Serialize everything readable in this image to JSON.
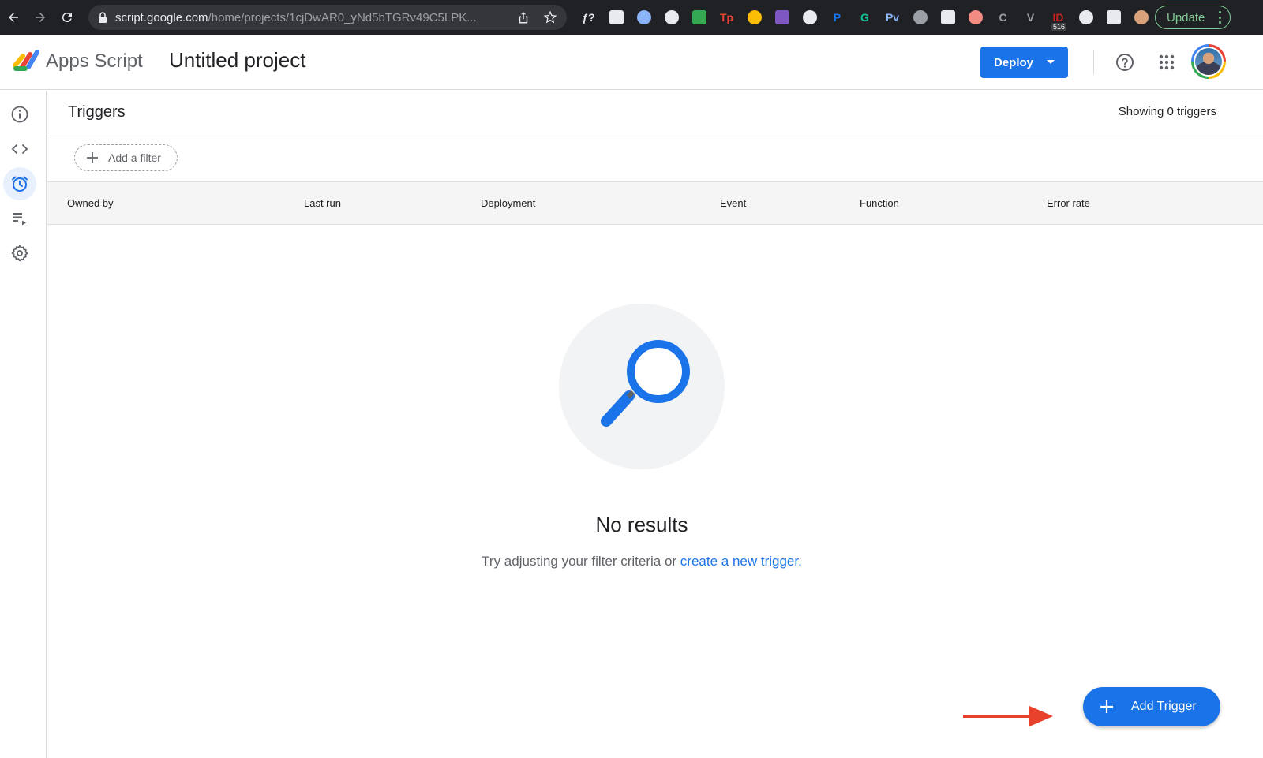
{
  "browser": {
    "url_domain": "script.google.com",
    "url_path": "/home/projects/1cjDwAR0_yNd5bTGRv49C5LPK...",
    "update_label": "Update",
    "extensions": [
      {
        "name": "formula-ext-icon",
        "label": "ƒ?",
        "color": "#e8eaed"
      },
      {
        "name": "react-ext-icon",
        "color": "#e8eaed"
      },
      {
        "name": "circle-blue-ext-icon",
        "color": "#8ab4f8"
      },
      {
        "name": "gear-ext-icon",
        "color": "#e8eaed"
      },
      {
        "name": "github-ext-icon",
        "color": "#34a853"
      },
      {
        "name": "tp-ext-icon",
        "label": "Tp",
        "color": "#ea4335"
      },
      {
        "name": "colorwheel-ext-icon",
        "color": "#fbbc04"
      },
      {
        "name": "purple-diamond-ext-icon",
        "color": "#7e57c2"
      },
      {
        "name": "power-ext-icon",
        "color": "#e8eaed"
      },
      {
        "name": "p-blue-ext-icon",
        "label": "P",
        "color": "#1a73e8"
      },
      {
        "name": "grammarly-ext-icon",
        "label": "G",
        "color": "#15c39a"
      },
      {
        "name": "pv-ext-icon",
        "label": "Pv",
        "color": "#8ab4f8"
      },
      {
        "name": "grey-dot-ext-icon",
        "color": "#9aa0a6"
      },
      {
        "name": "compass-ext-icon",
        "color": "#e8eaed"
      },
      {
        "name": "owl-ext-icon",
        "color": "#f28b82"
      },
      {
        "name": "c-ext-icon",
        "label": "C",
        "color": "#9aa0a6"
      },
      {
        "name": "vue-ext-icon",
        "label": "V",
        "color": "#9aa0a6"
      },
      {
        "name": "id-ext-icon",
        "label": "ID",
        "color": "#c5221f",
        "badge": "516"
      },
      {
        "name": "puzzle-ext-icon",
        "color": "#e8eaed"
      },
      {
        "name": "sidepanel-ext-icon",
        "color": "#e8eaed"
      },
      {
        "name": "profile-ext-icon",
        "color": "#d9a27a"
      }
    ]
  },
  "header": {
    "product_name": "Apps Script",
    "project_title": "Untitled project",
    "deploy_label": "Deploy"
  },
  "rail": {
    "items": [
      {
        "name": "overview-icon",
        "active": false
      },
      {
        "name": "editor-icon",
        "active": false
      },
      {
        "name": "triggers-icon",
        "active": true
      },
      {
        "name": "executions-icon",
        "active": false
      },
      {
        "name": "settings-icon",
        "active": false
      }
    ]
  },
  "main": {
    "title": "Triggers",
    "showing": "Showing 0 triggers",
    "filter_label": "Add a filter",
    "columns": [
      "Owned by",
      "Last run",
      "Deployment",
      "Event",
      "Function",
      "Error rate"
    ],
    "empty_title": "No results",
    "empty_text": "Try adjusting your filter criteria or",
    "empty_link": "create a new trigger.",
    "fab_label": "Add Trigger"
  },
  "colors": {
    "accent": "#1a73e8",
    "arrow": "#e8412c"
  }
}
